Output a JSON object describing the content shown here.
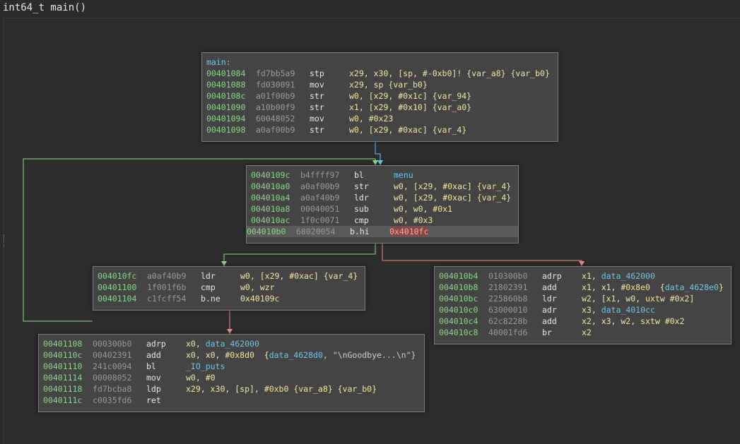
{
  "title": "int64_t main()",
  "colors": {
    "address": "#8bd58b",
    "bytes": "#9a9a9a",
    "mnemonic": "#e8e8e8",
    "operand": "#f0e6a8",
    "symbol": "#6fc5ea",
    "edge_true": "#8bd58b",
    "edge_false": "#e88a8a",
    "edge_unconditional": "#6fc5ea"
  },
  "blocks": [
    {
      "id": "block-main",
      "label": "main:",
      "rows": [
        {
          "addr": "00401084",
          "bytes": "fd7bb5a9",
          "mn": "stp",
          "ops": [
            {
              "t": "x29, x30, [sp, #-0xb0]! {var_a8} {var_b0}",
              "c": "op"
            }
          ]
        },
        {
          "addr": "00401088",
          "bytes": "fd030091",
          "mn": "mov",
          "ops": [
            {
              "t": "x29, sp {var_b0}",
              "c": "op"
            }
          ]
        },
        {
          "addr": "0040108c",
          "bytes": "a01f00b9",
          "mn": "str",
          "ops": [
            {
              "t": "w0, [x29, #0x1c] {var_94}",
              "c": "op"
            }
          ]
        },
        {
          "addr": "00401090",
          "bytes": "a10b00f9",
          "mn": "str",
          "ops": [
            {
              "t": "x1, [x29, #0x10] {var_a0}",
              "c": "op"
            }
          ]
        },
        {
          "addr": "00401094",
          "bytes": "60048052",
          "mn": "mov",
          "ops": [
            {
              "t": "w0, #0x23",
              "c": "op"
            }
          ]
        },
        {
          "addr": "00401098",
          "bytes": "a0af00b9",
          "mn": "str",
          "ops": [
            {
              "t": "w0, [x29, #0xac] {var_4}",
              "c": "op"
            }
          ]
        }
      ]
    },
    {
      "id": "block-loop",
      "label": "",
      "rows": [
        {
          "addr": "0040109c",
          "bytes": "b4ffff97",
          "mn": "bl",
          "ops": [
            {
              "t": "menu",
              "c": "sym"
            }
          ]
        },
        {
          "addr": "004010a0",
          "bytes": "a0af00b9",
          "mn": "str",
          "ops": [
            {
              "t": "w0, [x29, #0xac] {var_4}",
              "c": "op"
            }
          ]
        },
        {
          "addr": "004010a4",
          "bytes": "a0af40b9",
          "mn": "ldr",
          "ops": [
            {
              "t": "w0, [x29, #0xac] {var_4}",
              "c": "op"
            }
          ]
        },
        {
          "addr": "004010a8",
          "bytes": "00040051",
          "mn": "sub",
          "ops": [
            {
              "t": "w0, w0, #0x1",
              "c": "op"
            }
          ]
        },
        {
          "addr": "004010ac",
          "bytes": "1f0c0071",
          "mn": "cmp",
          "ops": [
            {
              "t": "w0, #0x3",
              "c": "op"
            }
          ]
        },
        {
          "addr": "004010b0",
          "bytes": "68020054",
          "mn": "b.hi",
          "ops": [
            {
              "t": "0x4010fc",
              "c": "hlop"
            }
          ],
          "highlight": true
        }
      ]
    },
    {
      "id": "block-check",
      "label": "",
      "rows": [
        {
          "addr": "004010fc",
          "bytes": "a0af40b9",
          "mn": "ldr",
          "ops": [
            {
              "t": "w0, [x29, #0xac] {var_4}",
              "c": "op"
            }
          ]
        },
        {
          "addr": "00401100",
          "bytes": "1f001f6b",
          "mn": "cmp",
          "ops": [
            {
              "t": "w0, wzr",
              "c": "op"
            }
          ]
        },
        {
          "addr": "00401104",
          "bytes": "c1fcff54",
          "mn": "b.ne",
          "ops": [
            {
              "t": "0x40109c",
              "c": "op"
            }
          ]
        }
      ]
    },
    {
      "id": "block-switch",
      "label": "",
      "rows": [
        {
          "addr": "004010b4",
          "bytes": "010300b0",
          "mn": "adrp",
          "ops": [
            {
              "t": "x1, ",
              "c": "op"
            },
            {
              "t": "data_462000",
              "c": "sym"
            }
          ]
        },
        {
          "addr": "004010b8",
          "bytes": "21802391",
          "mn": "add",
          "ops": [
            {
              "t": "x1, x1, #0x8e0  {",
              "c": "op"
            },
            {
              "t": "data_4628e0",
              "c": "sym"
            },
            {
              "t": "}",
              "c": "op"
            }
          ]
        },
        {
          "addr": "004010bc",
          "bytes": "225860b8",
          "mn": "ldr",
          "ops": [
            {
              "t": "w2, [x1, w0, uxtw #0x2]",
              "c": "op"
            }
          ]
        },
        {
          "addr": "004010c0",
          "bytes": "63000010",
          "mn": "adr",
          "ops": [
            {
              "t": "x3, ",
              "c": "op"
            },
            {
              "t": "data_4010cc",
              "c": "sym"
            }
          ]
        },
        {
          "addr": "004010c4",
          "bytes": "62c8228b",
          "mn": "add",
          "ops": [
            {
              "t": "x2, x3, w2, sxtw #0x2",
              "c": "op"
            }
          ]
        },
        {
          "addr": "004010c8",
          "bytes": "40001fd6",
          "mn": "br",
          "ops": [
            {
              "t": "x2",
              "c": "op"
            }
          ]
        }
      ]
    },
    {
      "id": "block-exit",
      "label": "",
      "rows": [
        {
          "addr": "00401108",
          "bytes": "000300b0",
          "mn": "adrp",
          "ops": [
            {
              "t": "x0, ",
              "c": "op"
            },
            {
              "t": "data_462000",
              "c": "sym"
            }
          ]
        },
        {
          "addr": "0040110c",
          "bytes": "00402391",
          "mn": "add",
          "ops": [
            {
              "t": "x0, x0, #0x8d0  {",
              "c": "op"
            },
            {
              "t": "data_4628d0",
              "c": "sym"
            },
            {
              "t": ", \"\\nGoodbye...\\n\"}",
              "c": "grey"
            }
          ]
        },
        {
          "addr": "00401110",
          "bytes": "241c0094",
          "mn": "bl",
          "ops": [
            {
              "t": "_IO_puts",
              "c": "sym"
            }
          ]
        },
        {
          "addr": "00401114",
          "bytes": "00008052",
          "mn": "mov",
          "ops": [
            {
              "t": "w0, #0",
              "c": "op"
            }
          ]
        },
        {
          "addr": "00401118",
          "bytes": "fd7bcba8",
          "mn": "ldp",
          "ops": [
            {
              "t": "x29, x30, [sp], #0xb0 {var_a8} {var_b0}",
              "c": "op"
            }
          ]
        },
        {
          "addr": "0040111c",
          "bytes": "c0035fd6",
          "mn": "ret",
          "ops": []
        }
      ]
    }
  ]
}
